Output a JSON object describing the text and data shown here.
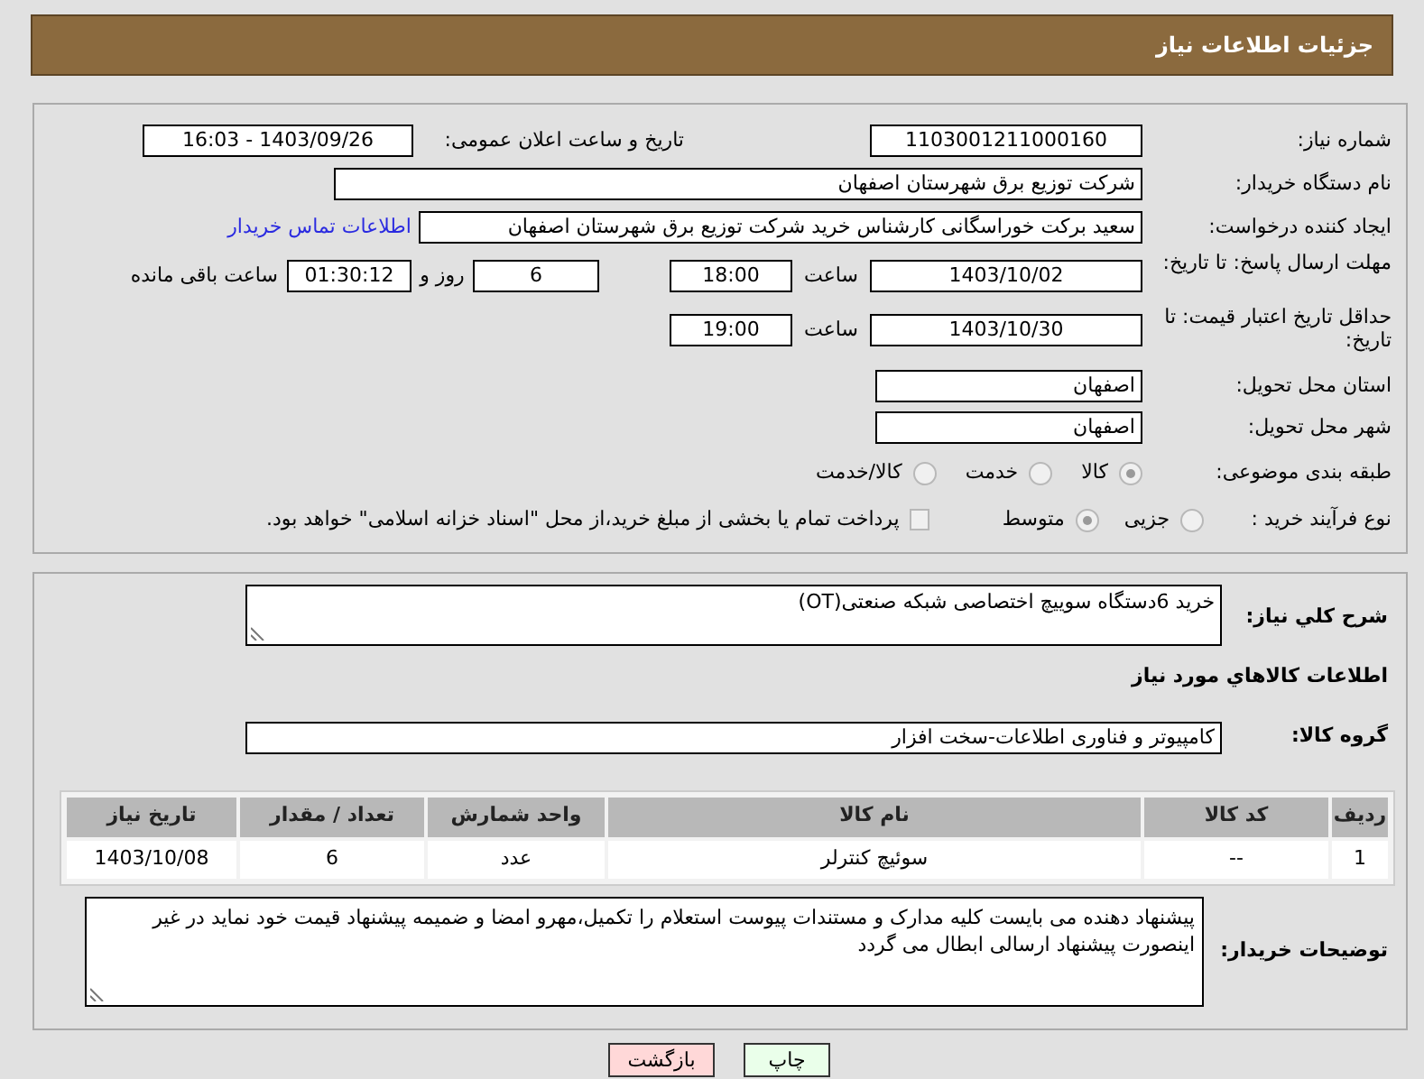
{
  "header": {
    "title": "جزئیات اطلاعات نیاز"
  },
  "need_number": {
    "label": "شماره نیاز:",
    "value": "1103001211000160"
  },
  "announce": {
    "label": "تاریخ و ساعت اعلان عمومی:",
    "value": "1403/09/26 - 16:03"
  },
  "buyer_org": {
    "label": "نام دستگاه خریدار:",
    "value": "شرکت توزیع برق شهرستان اصفهان"
  },
  "requester": {
    "label": "ایجاد کننده درخواست:",
    "value": "سعید برکت خوراسگانی کارشناس خرید شرکت توزیع برق شهرستان اصفهان",
    "link": "اطلاعات تماس خریدار"
  },
  "reply_deadline": {
    "label": "مهلت ارسال پاسخ: تا تاریخ:",
    "date": "1403/10/02",
    "time_label": "ساعت",
    "time": "18:00",
    "days": "6",
    "days_suffix": "روز و",
    "remaining": "01:30:12",
    "remaining_suffix": "ساعت باقی مانده"
  },
  "price_validity": {
    "label": "حداقل تاریخ اعتبار قیمت: تا تاریخ:",
    "date": "1403/10/30",
    "time_label": "ساعت",
    "time": "19:00"
  },
  "province": {
    "label": "استان محل تحویل:",
    "value": "اصفهان"
  },
  "city": {
    "label": "شهر محل تحویل:",
    "value": "اصفهان"
  },
  "category": {
    "label": "طبقه بندی موضوعی:",
    "options": [
      {
        "label": "کالا",
        "selected": true
      },
      {
        "label": "خدمت",
        "selected": false
      },
      {
        "label": "کالا/خدمت",
        "selected": false
      }
    ]
  },
  "process": {
    "label": "نوع فرآیند خرید :",
    "options": [
      {
        "label": "جزیی",
        "selected": false
      },
      {
        "label": "متوسط",
        "selected": true
      }
    ],
    "payment_note": {
      "text": "پرداخت تمام یا بخشی از مبلغ خرید،از محل \"اسناد خزانه اسلامی\" خواهد بود.",
      "checked": false
    }
  },
  "description": {
    "label": "شرح کلي نیاز:",
    "value": "خرید 6دستگاه سوییچ اختصاصی شبکه صنعتی(OT)"
  },
  "goods_title": "اطلاعات کالاهاي مورد نیاز",
  "goods_group": {
    "label": "گروه کالا:",
    "value": "کامپیوتر و فناوری اطلاعات-سخت افزار"
  },
  "table": {
    "columns": [
      "ردیف",
      "کد کالا",
      "نام کالا",
      "واحد شمارش",
      "تعداد / مقدار",
      "تاریخ نیاز"
    ],
    "rows": [
      [
        "1",
        "--",
        "سوئیچ کنترلر",
        "عدد",
        "6",
        "1403/10/08"
      ]
    ]
  },
  "buyer_notes": {
    "label": "توضیحات خریدار:",
    "value": "پیشنهاد دهنده می بایست کلیه مدارک و مستندات پیوست استعلام را تکمیل،مهرو امضا و ضمیمه پیشنهاد قیمت خود نماید در غیر اینصورت پیشنهاد ارسالی ابطال می گردد"
  },
  "buttons": [
    {
      "label": "چاپ",
      "kind": "print"
    },
    {
      "label": "بازگشت",
      "kind": "back"
    }
  ]
}
